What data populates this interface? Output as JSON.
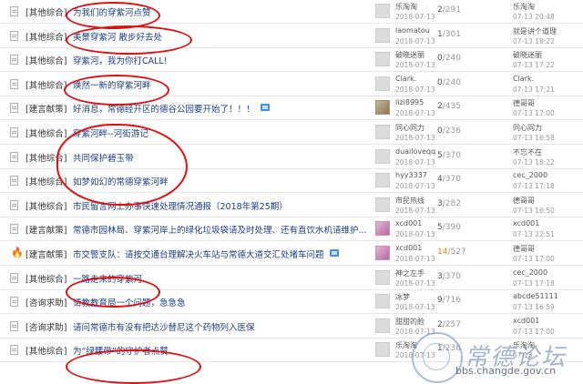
{
  "rows": [
    {
      "category": "[其他综合]",
      "title": "为我们的穿紫河点赞",
      "author": "乐淘淘",
      "date": "2018-07-13",
      "replies": "2",
      "views": "291",
      "last_user": "乐淘淘",
      "last_time": "07-13 20:48"
    },
    {
      "category": "[其他综合]",
      "title": "美景穿紫河  散步好去处",
      "author": "laomatou",
      "date": "2018-07-13",
      "replies": "1",
      "views": "301",
      "last_user": "就是讲个道理",
      "last_time": "07-13 18:22"
    },
    {
      "category": "[其他综合]",
      "title": "穿紫河，我为你打CALL!",
      "author": "破晓迷丽",
      "date": "2018-07-13",
      "replies": "0",
      "views": "240",
      "last_user": "破晓迷丽",
      "last_time": "07-13 17:22"
    },
    {
      "category": "[其他综合]",
      "title": "焕然一新的穿紫河畔",
      "author": "Clark.",
      "date": "2018-07-13",
      "replies": "0",
      "views": "240",
      "last_user": "Clark.",
      "last_time": "07-13 17:21"
    },
    {
      "category": "[建言献策]",
      "title": "好消息，常德经开区的德谷公园要开始了！！！",
      "author": "lizi8995",
      "date": "2018-07-13",
      "replies": "2",
      "views": "435",
      "last_user": "德哥哥",
      "last_time": "07-13 17:00"
    },
    {
      "category": "[其他综合]",
      "title": "穿紫河畔--河街游记",
      "author": "同心同力",
      "date": "2018-07-13",
      "replies": "0",
      "views": "236",
      "last_user": "同心同力",
      "last_time": "07-13 16:58"
    },
    {
      "category": "[其他综合]",
      "title": "共同保护碧玉带",
      "author": "duailoveqq",
      "date": "2018-07-13",
      "replies": "5",
      "views": "370",
      "last_user": "不忘不在",
      "last_time": "07-13 18:22"
    },
    {
      "category": "[其他综合]",
      "title": "如梦如幻的常德穿紫河畔",
      "author": "hyy3337",
      "date": "2018-07-13",
      "replies": "4",
      "views": "370",
      "last_user": "cec_2000",
      "last_time": "07-13 17:18"
    },
    {
      "category": "[其他综合]",
      "title": "市民留言网上办事快速处理情况通报（2018年第25期）",
      "author": "市民热线",
      "date": "2018-07-13",
      "replies": "3",
      "views": "282",
      "last_user": "德哥哥",
      "last_time": "07-13 16:50"
    },
    {
      "category": "[建言献策]",
      "title": "常德市园林局、穿紫河岸上的绿化垃圾袋请及时处理、还有直饮水机请维护...",
      "author": "xcd001",
      "date": "2018-07-13",
      "replies": "5",
      "views": "390",
      "last_user": "xcd001",
      "last_time": "07-13 22:51"
    },
    {
      "category": "[建言献策]",
      "title": "市交警支队：请按交通台理解决火车站与常德大道交汇处堵车问题",
      "author": "xcd001",
      "date": "2018-07-13",
      "replies": "14",
      "views": "527",
      "last_user": "德哥哥",
      "last_time": "07-13 17:00"
    },
    {
      "category": "[其他综合]",
      "title": "一路走来的穿紫河",
      "author": "神之左手",
      "date": "2018-07-13",
      "replies": "3",
      "views": "370",
      "last_user": "cec_2000",
      "last_time": "07-13 17:18"
    },
    {
      "category": "[咨询求助]",
      "title": "请教教育局一个问题，急急急",
      "author": "冰梦",
      "date": "2018-07-13",
      "replies": "9",
      "views": "716",
      "last_user": "abcde51111",
      "last_time": "07-13 16:59"
    },
    {
      "category": "[咨询求助]",
      "title": "请问常德市有没有把达沙替尼这个药物列入医保",
      "author": "甜甜的脸",
      "date": "2018-07-13",
      "replies": "2",
      "views": "257",
      "last_user": "xcd001",
      "last_time": "07-13 17:00"
    },
    {
      "category": "[其他综合]",
      "title": "为“绿腰带”的守护者点赞",
      "author": "乐淘淘",
      "date": "2018-07-13",
      "replies": "1",
      "views": "236",
      "last_user": "乐淘淘",
      "last_time": "07-13"
    }
  ],
  "watermark": {
    "text": "常德论坛",
    "url": "bbs.changde.gov.cn"
  },
  "colors": {
    "title_link": "#1a3d8a",
    "hot_replies": "#e08a1b",
    "annotation": "#e01010"
  },
  "icons": {
    "thread": "document-icon",
    "hot": "fire-icon",
    "image": "image-attachment-icon"
  }
}
